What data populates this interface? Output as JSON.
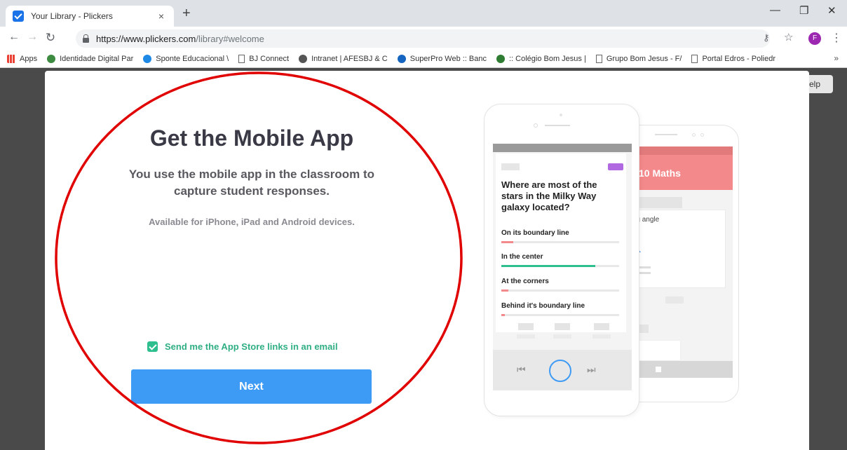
{
  "browser": {
    "tab_title": "Your Library - Plickers",
    "tab_close": "×",
    "new_tab": "+",
    "url_host": "https://www.plickers.com",
    "url_path": "/library#welcome",
    "avatar_letter": "F",
    "win_minimize": "—",
    "win_restore": "❐",
    "win_close": "✕"
  },
  "bookmarks": [
    {
      "label": "Apps",
      "icon": "apps-icon",
      "color": "#e94235"
    },
    {
      "label": "Identidade Digital Par",
      "icon": "leaf-icon",
      "color": "#3d8b40"
    },
    {
      "label": "Sponte Educacional \\",
      "icon": "sponte-icon",
      "color": "#1e88e5"
    },
    {
      "label": "BJ Connect",
      "icon": "page-icon",
      "color": "#ffffff"
    },
    {
      "label": "Intranet | AFESBJ & C",
      "icon": "intranet-icon",
      "color": "#555555"
    },
    {
      "label": "SuperPro Web :: Banc",
      "icon": "superpro-icon",
      "color": "#1565c0"
    },
    {
      "label": ":: Colégio Bom Jesus |",
      "icon": "bomjesus-icon",
      "color": "#2e7d32"
    },
    {
      "label": "Grupo Bom Jesus - F/",
      "icon": "page-icon",
      "color": "#ffffff"
    },
    {
      "label": "Portal Edros - Poliedr",
      "icon": "page-icon",
      "color": "#ffffff"
    }
  ],
  "bookmarks_more": "»",
  "page": {
    "help_label": "elp"
  },
  "modal": {
    "title": "Get the Mobile App",
    "subtitle": "You use the mobile app in the classroom to capture student responses.",
    "availability": "Available for iPhone, iPad and Android devices.",
    "email_checkbox_label": "Send me the App Store links in an email",
    "email_checkbox_checked": true,
    "next_label": "Next"
  },
  "phone_front": {
    "question": "Where are most of the stars in the Milky Way galaxy located?",
    "answers": [
      {
        "label": "On its boundary line",
        "fill": 0.1,
        "color": "#f4898b"
      },
      {
        "label": "In the center",
        "fill": 0.8,
        "color": "#2fbf8e"
      },
      {
        "label": "At the corners",
        "fill": 0.06,
        "color": "#f4898b"
      },
      {
        "label": "Behind it's boundary line",
        "fill": 0.03,
        "color": "#f4898b"
      }
    ],
    "prev_icon": "skip-previous-icon",
    "next_icon": "skip-next-icon"
  },
  "phone_back": {
    "header": "10 Maths",
    "card_text": "d the missing angle"
  },
  "colors": {
    "accent": "#3d9bf5",
    "success": "#2fbf8e",
    "annotation": "#e00000"
  }
}
